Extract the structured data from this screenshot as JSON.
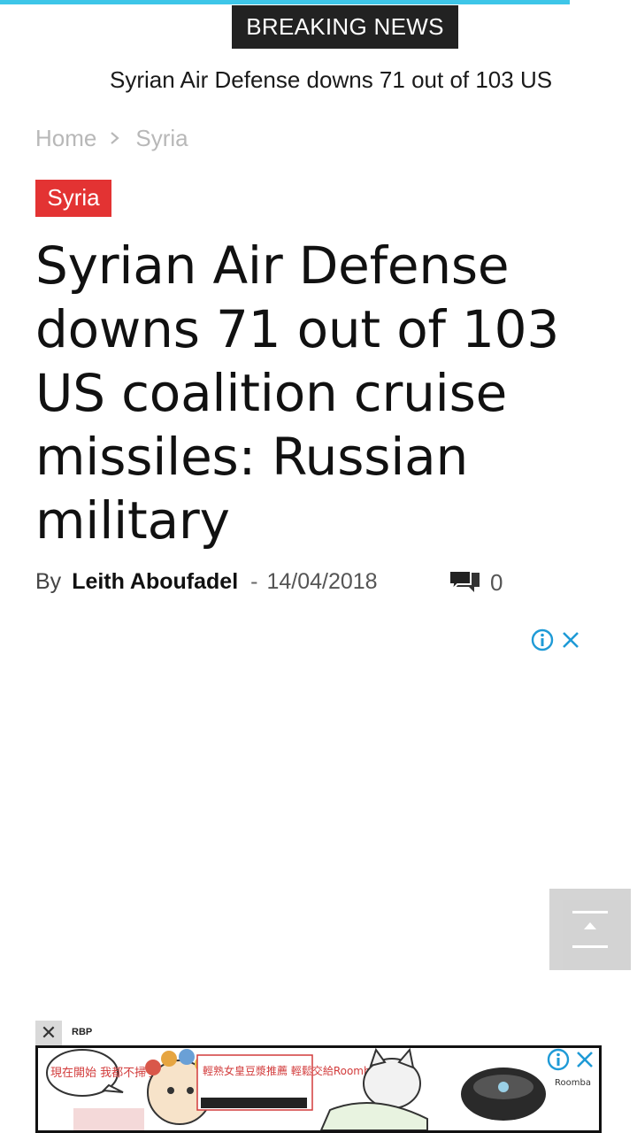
{
  "header": {
    "breaking_label": "BREAKING NEWS",
    "ticker_text": "Syrian Air Defense downs 71 out of 103 US"
  },
  "breadcrumb": {
    "home": "Home",
    "section": "Syria"
  },
  "article": {
    "category": "Syria",
    "title": "Syrian Air Defense downs 71 out of 103 US coalition cruise missiles: Russian military",
    "by_label": "By",
    "author": "Leith Aboufadel",
    "separator": "-",
    "date": "14/04/2018",
    "comment_count": "0"
  },
  "ads": {
    "bottom_label": "RBP",
    "bottom_close": "✕",
    "bottom_text_left": "現在開始 我都不掃了!",
    "bottom_text_middle": "輕熟女皇豆漿推薦 輕鬆交給Roomba就實在",
    "bottom_brand": "Roomba"
  },
  "colors": {
    "accent_line": "#3ec6e8",
    "category_red": "#e33333",
    "ad_icon_blue": "#1e9ad6",
    "badge_dark": "#222222"
  }
}
